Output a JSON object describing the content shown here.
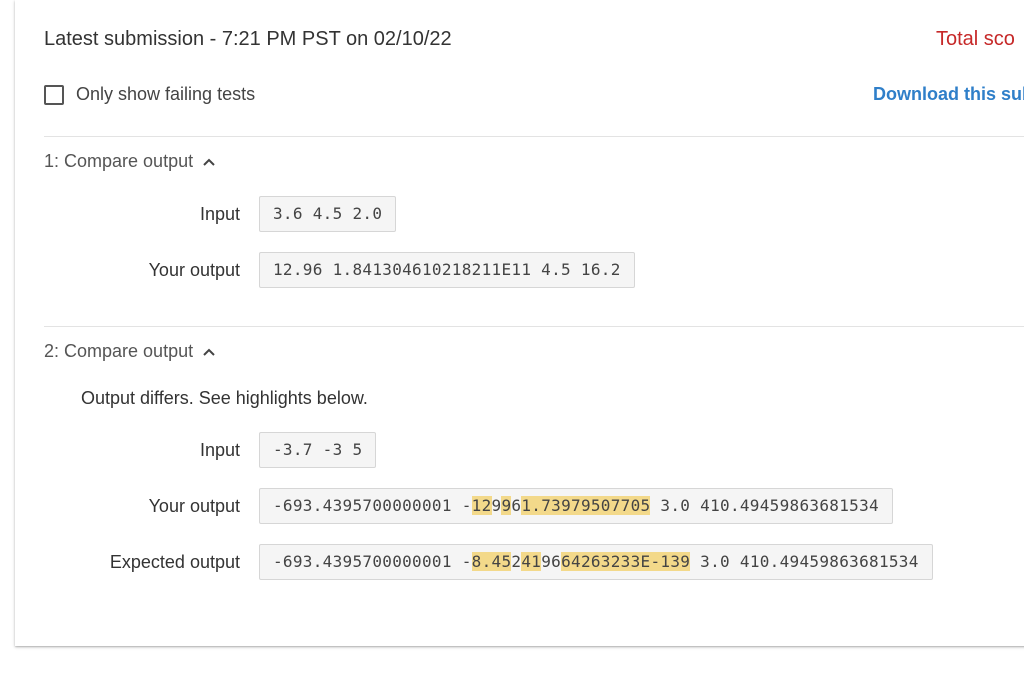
{
  "header": {
    "title": "Latest submission - 7:21 PM PST on 02/10/22",
    "total_score": "Total sco"
  },
  "filter": {
    "label": "Only show failing tests",
    "checked": false
  },
  "download": {
    "label": "Download this sub"
  },
  "tests": [
    {
      "title": "1: Compare output",
      "input_label": "Input",
      "input_value": "3.6 4.5 2.0",
      "your_output_label": "Your output",
      "your_output_value": "12.96 1.841304610218211E11 4.5 16.2"
    },
    {
      "title": "2: Compare output",
      "message": "Output differs. See highlights below.",
      "input_label": "Input",
      "input_value": "-3.7 -3 5",
      "your_output_label": "Your output",
      "your_output_segments": [
        {
          "text": "-693.4395700000001 -",
          "hl": false
        },
        {
          "text": "12",
          "hl": true
        },
        {
          "text": "9",
          "hl": false
        },
        {
          "text": "9",
          "hl": true
        },
        {
          "text": "6",
          "hl": false
        },
        {
          "text": "1.73979507705",
          "hl": true
        },
        {
          "text": " 3.0 410.49459863681534",
          "hl": false
        }
      ],
      "expected_output_label": "Expected output",
      "expected_output_segments": [
        {
          "text": "-693.4395700000001 -",
          "hl": false
        },
        {
          "text": "8.45",
          "hl": true
        },
        {
          "text": "2",
          "hl": false
        },
        {
          "text": "41",
          "hl": true
        },
        {
          "text": "96",
          "hl": false
        },
        {
          "text": "64263233E-139",
          "hl": true
        },
        {
          "text": " 3.0 410.49459863681534",
          "hl": false
        }
      ]
    }
  ],
  "colors": {
    "score": "#c62828",
    "link": "#2f7fc9",
    "highlight": "#f3d98a"
  }
}
